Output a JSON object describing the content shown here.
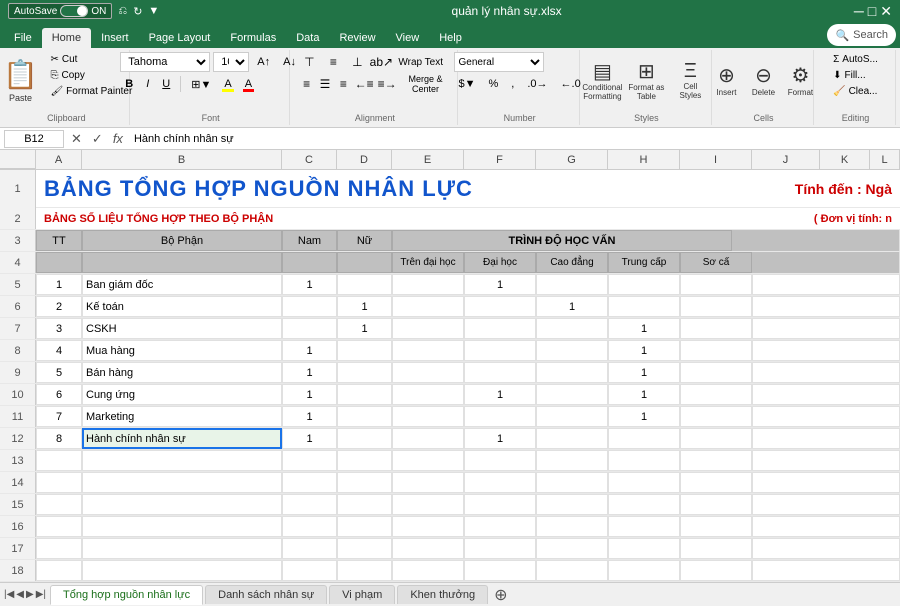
{
  "titlebar": {
    "autosave_label": "AutoSave",
    "autosave_on": "ON",
    "filename": "quản lý nhân sự.xlsx",
    "undo_icon": "↩",
    "redo_icon": "↪"
  },
  "ribbon_tabs": [
    "File",
    "Home",
    "Insert",
    "Page Layout",
    "Formulas",
    "Data",
    "Review",
    "View",
    "Help"
  ],
  "active_tab": "Home",
  "search_placeholder": "Search",
  "clipboard": {
    "label": "Clipboard",
    "paste_label": "Paste",
    "cut_label": "Cut",
    "copy_label": "Copy",
    "format_painter_label": "Format Painter"
  },
  "font": {
    "label": "Font",
    "current_font": "Tahoma",
    "current_size": "10",
    "bold": "B",
    "italic": "I",
    "underline": "U"
  },
  "alignment": {
    "label": "Alignment",
    "wrap_text": "Wrap Text",
    "merge_center": "Merge & Center"
  },
  "number": {
    "label": "Number",
    "format": "General"
  },
  "styles": {
    "label": "Styles",
    "conditional_label": "Conditional\nFormatting",
    "format_table_label": "Format as\nTable",
    "cell_styles_label": "Cell\nStyles"
  },
  "cells": {
    "label": "Cells",
    "insert_label": "Insert",
    "delete_label": "Delete",
    "format_label": "Format"
  },
  "formula_bar": {
    "cell_ref": "B12",
    "formula_value": "Hành chính nhân sự"
  },
  "sheet": {
    "main_title": "BẢNG TỔNG HỢP NGUỒN NHÂN LỰC",
    "title_right": "Tính đến : Ngà",
    "subtitle": "BẢNG SỐ LIỆU TỔNG HỢP THEO BỘ PHẬN",
    "unit": "( Đơn vị tính: n",
    "col_headers": [
      "A",
      "B",
      "C",
      "D",
      "E",
      "F",
      "G",
      "H",
      "I",
      "J",
      "K",
      "L"
    ],
    "row3_headers": {
      "tt": "TT",
      "bo_phan": "Bộ Phận",
      "nam": "Nam",
      "nu": "Nữ",
      "trinh_do": "TRÌNH ĐỘ HỌC VẤN"
    },
    "row4_headers": {
      "tren_dh": "Trên đại học",
      "dh": "Đại học",
      "cd": "Cao đẳng",
      "tc": "Trung cấp",
      "sc": "Sơ cấ"
    },
    "rows": [
      {
        "row": 5,
        "tt": "1",
        "bo_phan": "Ban giám đốc",
        "nam": "1",
        "nu": "",
        "tren_dh": "",
        "dh": "1",
        "cd": "",
        "tc": "",
        "sc": ""
      },
      {
        "row": 6,
        "tt": "2",
        "bo_phan": "Kế toán",
        "nam": "",
        "nu": "1",
        "tren_dh": "",
        "dh": "",
        "cd": "1",
        "tc": "",
        "sc": ""
      },
      {
        "row": 7,
        "tt": "3",
        "bo_phan": "CSKH",
        "nam": "",
        "nu": "1",
        "tren_dh": "",
        "dh": "",
        "cd": "",
        "tc": "1",
        "sc": ""
      },
      {
        "row": 8,
        "tt": "4",
        "bo_phan": "Mua hàng",
        "nam": "1",
        "nu": "",
        "tren_dh": "",
        "dh": "",
        "cd": "",
        "tc": "1",
        "sc": ""
      },
      {
        "row": 9,
        "tt": "5",
        "bo_phan": "Bán hàng",
        "nam": "1",
        "nu": "",
        "tren_dh": "",
        "dh": "",
        "cd": "",
        "tc": "1",
        "sc": ""
      },
      {
        "row": 10,
        "tt": "6",
        "bo_phan": "Cung ứng",
        "nam": "1",
        "nu": "",
        "tren_dh": "",
        "dh": "1",
        "cd": "",
        "tc": "1",
        "sc": ""
      },
      {
        "row": 11,
        "tt": "7",
        "bo_phan": "Marketing",
        "nam": "1",
        "nu": "",
        "tren_dh": "",
        "dh": "",
        "cd": "",
        "tc": "1",
        "sc": ""
      },
      {
        "row": 12,
        "tt": "8",
        "bo_phan": "Hành chính nhân sự",
        "nam": "1",
        "nu": "",
        "tren_dh": "",
        "dh": "1",
        "cd": "",
        "tc": "",
        "sc": ""
      },
      {
        "row": 13,
        "tt": "",
        "bo_phan": "",
        "nam": "",
        "nu": "",
        "tren_dh": "",
        "dh": "",
        "cd": "",
        "tc": "",
        "sc": ""
      },
      {
        "row": 14,
        "tt": "",
        "bo_phan": "",
        "nam": "",
        "nu": "",
        "tren_dh": "",
        "dh": "",
        "cd": "",
        "tc": "",
        "sc": ""
      },
      {
        "row": 15,
        "tt": "",
        "bo_phan": "",
        "nam": "",
        "nu": "",
        "tren_dh": "",
        "dh": "",
        "cd": "",
        "tc": "",
        "sc": ""
      },
      {
        "row": 16,
        "tt": "",
        "bo_phan": "",
        "nam": "",
        "nu": "",
        "tren_dh": "",
        "dh": "",
        "cd": "",
        "tc": "",
        "sc": ""
      },
      {
        "row": 17,
        "tt": "",
        "bo_phan": "",
        "nam": "",
        "nu": "",
        "tren_dh": "",
        "dh": "",
        "cd": "",
        "tc": "",
        "sc": ""
      },
      {
        "row": 18,
        "tt": "",
        "bo_phan": "",
        "nam": "",
        "nu": "",
        "tren_dh": "",
        "dh": "",
        "cd": "",
        "tc": "",
        "sc": ""
      }
    ]
  },
  "sheet_tabs": [
    {
      "name": "Tổng hợp nguồn nhân lực",
      "active": true
    },
    {
      "name": "Danh sách nhân sự",
      "active": false
    },
    {
      "name": "Vi phạm",
      "active": false
    },
    {
      "name": "Khen thưởng",
      "active": false
    }
  ]
}
